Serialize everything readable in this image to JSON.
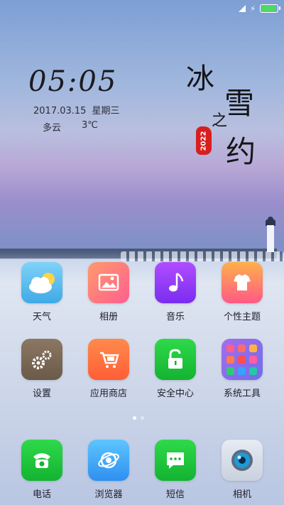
{
  "status_bar": {
    "battery_level": 1.0,
    "battery_color": "#4cd964",
    "icons": [
      "signal-icon",
      "charging-bolt-icon",
      "battery-icon"
    ]
  },
  "lock_widget": {
    "time": "05:05",
    "date": "2017.03.15",
    "weekday": "星期三",
    "weather": "多云",
    "temperature": "3℃"
  },
  "wallpaper_text": {
    "line1": "冰",
    "line2": "雪",
    "line3": "之",
    "line4": "约",
    "seal": "2022",
    "seal_color": "#d81f1f"
  },
  "apps_row1": [
    {
      "label": "天气",
      "icon": "weather-icon"
    },
    {
      "label": "相册",
      "icon": "gallery-icon"
    },
    {
      "label": "音乐",
      "icon": "music-icon"
    },
    {
      "label": "个性主题",
      "icon": "themes-icon"
    }
  ],
  "apps_row2": [
    {
      "label": "设置",
      "icon": "settings-icon"
    },
    {
      "label": "应用商店",
      "icon": "app-store-icon"
    },
    {
      "label": "安全中心",
      "icon": "security-icon"
    },
    {
      "label": "系统工具",
      "icon": "tools-folder-icon"
    }
  ],
  "pager": {
    "current_page": 1,
    "total_pages": 2
  },
  "dock": [
    {
      "label": "电话",
      "icon": "phone-icon"
    },
    {
      "label": "浏览器",
      "icon": "browser-icon"
    },
    {
      "label": "短信",
      "icon": "messages-icon"
    },
    {
      "label": "相机",
      "icon": "camera-icon"
    }
  ]
}
